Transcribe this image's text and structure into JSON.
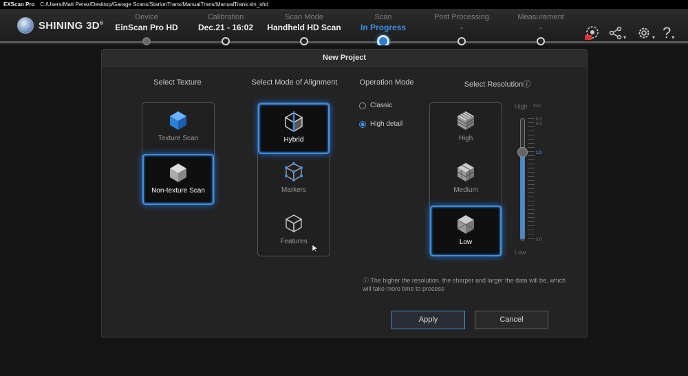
{
  "window": {
    "app_title": "EXScan Pro",
    "path": "C:/Users/Matt Perez/Desktop/Garage Scans/StarionTrans/ManualTrans/ManualTrans.sln_shd"
  },
  "brand": {
    "name": "SHINING 3D",
    "mark": "®"
  },
  "steps": [
    {
      "label": "Device",
      "value": "EinScan Pro HD"
    },
    {
      "label": "Calibration",
      "value": "Dec.21 - 16:02"
    },
    {
      "label": "Scan Mode",
      "value": "Handheld HD Scan"
    },
    {
      "label": "Scan",
      "value": "In Progress"
    },
    {
      "label": "Post Processing",
      "value": "-"
    },
    {
      "label": "Measurement",
      "value": "-"
    }
  ],
  "toolbar": {
    "share_icon": "share-icon",
    "settings_icon": "gear-icon",
    "help_icon": "help-icon",
    "help_glyph": "?",
    "dropdown_glyph": "▾"
  },
  "dialog": {
    "title": "New Project",
    "texture": {
      "heading": "Select Texture",
      "options": [
        "Texture Scan",
        "Non-texture Scan"
      ],
      "selected": "Non-texture Scan"
    },
    "alignment": {
      "heading": "Select Mode of Alignment",
      "options": [
        "Hybrid",
        "Markers",
        "Features"
      ],
      "selected": "Hybrid"
    },
    "operation": {
      "heading": "Operation Mode",
      "options": [
        "Classic",
        "High detail"
      ],
      "selected": "High detail"
    },
    "resolution": {
      "heading": "Select Resolution",
      "heading_glyph": "ⓘ",
      "options": [
        "High",
        "Medium",
        "Low"
      ],
      "selected": "Low",
      "slider": {
        "high_label": "High",
        "low_label": "Low",
        "unit": "mm",
        "ticks": [
          "0.2",
          "0.3",
          "1.0",
          "3.0"
        ],
        "value": 1.0,
        "min": 0.2,
        "max": 3.0
      }
    },
    "note_glyph": "ⓘ",
    "note": "The higher the resolution, the sharper and larger the data will be, which will take more time to process",
    "apply_label": "Apply",
    "cancel_label": "Cancel"
  },
  "colors": {
    "accent": "#3a8ee6",
    "background": "#161616",
    "dialog": "#232323"
  }
}
